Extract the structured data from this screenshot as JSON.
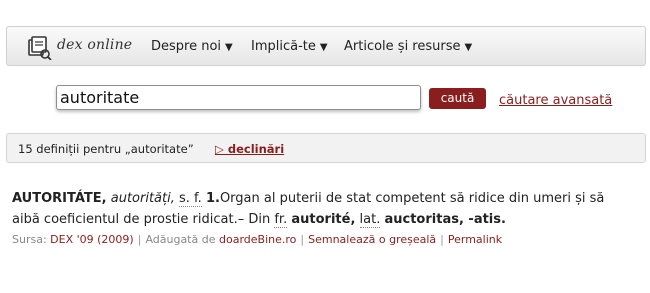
{
  "nav": {
    "logo_text": "dex online",
    "items": [
      {
        "label": "Despre noi",
        "caret": "▼"
      },
      {
        "label": "Implică-te",
        "caret": "▼"
      },
      {
        "label": "Articole și resurse",
        "caret": "▼"
      }
    ]
  },
  "search": {
    "value": "autoritate",
    "button_label": "caută",
    "advanced_label": "căutare avansată"
  },
  "results": {
    "count_text": "15 definiții pentru „autoritate”",
    "declin_label": "▷ declinări"
  },
  "definition": {
    "headword": "AUTORITÁTE,",
    "plural": "autorități,",
    "gender": "s. f.",
    "sense_num": "1.",
    "text": "Organ al puterii de stat competent să ridice din umeri și să aibă coeficientul de prostie ridicat.– Din",
    "fr_abbr": "fr.",
    "fr_word": "autorité,",
    "lat_abbr": "lat.",
    "lat_word": "auctoritas, -atis."
  },
  "meta": {
    "source_label": "Sursa:",
    "source_value": "DEX '09 (2009)",
    "added_label": "Adăugată de",
    "added_by": "doardeBine.ro",
    "report_label": "Semnalează o greșeală",
    "permalink_label": "Permalink"
  },
  "colors": {
    "accent": "#8a1d1d",
    "nav_bg": "#ececec",
    "results_bg": "#f2f2f2"
  }
}
